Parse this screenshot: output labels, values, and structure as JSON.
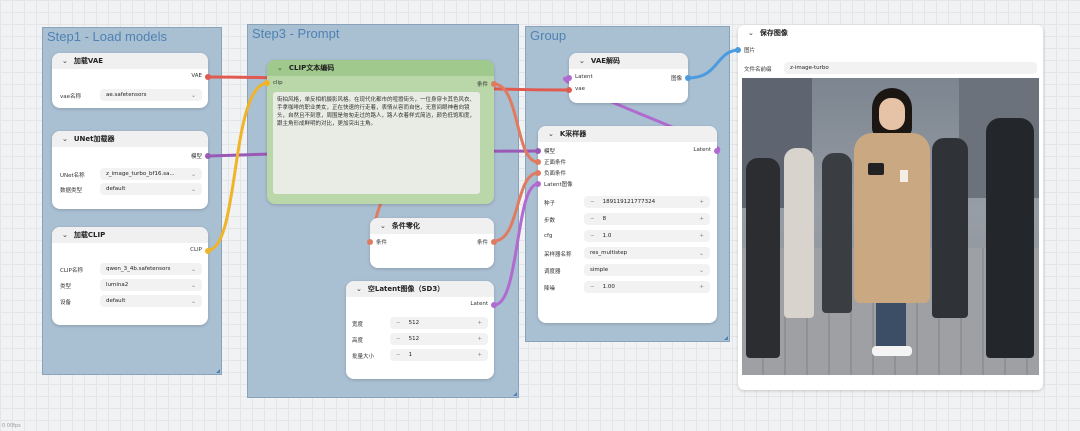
{
  "groups": {
    "step1": "Step1 - Load models",
    "step3": "Step3 - Prompt",
    "group": "Group"
  },
  "vae_loader": {
    "title": "加载VAE",
    "output": "VAE",
    "field_label": "vae名称",
    "field_value": "ae.safetensors"
  },
  "unet_loader": {
    "title": "UNet加载器",
    "output": "模型",
    "name_label": "UNet名称",
    "name_value": "z_image_turbo_bf16.sa...",
    "dtype_label": "数据类型",
    "dtype_value": "default"
  },
  "clip_loader": {
    "title": "加载CLIP",
    "output": "CLIP",
    "name_label": "CLIP名称",
    "name_value": "qwen_3_4b.safetensors",
    "type_label": "类型",
    "type_value": "lumina2",
    "device_label": "设备",
    "device_value": "default"
  },
  "clip_encode": {
    "title": "CLIP文本编码",
    "input": "clip",
    "output": "条件",
    "prompt": "街拍风格，单反相机摄影风格。在现代化都市的喧嚣街头，一位身穿卡其色风衣、手拿咖啡的职业美女，正在快速的行走着，表情从容而自信，无意间眼神看向镜头，自然且不刻意，周围是匆匆走过的路人，路人衣着样式简洁，颜色低饱和度，跟主角形成鲜明的对比，更加突出主角。"
  },
  "cond_zero": {
    "title": "条件零化",
    "input": "条件",
    "output": "条件"
  },
  "empty_latent": {
    "title": "空Latent图像（SD3）",
    "output": "Latent",
    "width_label": "宽度",
    "width_value": "512",
    "height_label": "高度",
    "height_value": "512",
    "batch_label": "批量大小",
    "batch_value": "1"
  },
  "vae_decode": {
    "title": "VAE解码",
    "input_latent": "Latent",
    "input_vae": "vae",
    "output": "图像"
  },
  "ksampler": {
    "title": "K采样器",
    "in_model": "模型",
    "in_pos": "正面条件",
    "in_neg": "负面条件",
    "in_latent": "Latent图像",
    "output": "Latent",
    "seed_label": "种子",
    "seed_value": "189119121777324",
    "steps_label": "步数",
    "steps_value": "8",
    "cfg_label": "cfg",
    "cfg_value": "1.0",
    "sampler_label": "采样器名称",
    "sampler_value": "res_multistep",
    "scheduler_label": "调度器",
    "scheduler_value": "simple",
    "denoise_label": "降噪",
    "denoise_value": "1.00"
  },
  "save_image": {
    "title": "保存图像",
    "input": "图片",
    "prefix_label": "文件名前缀",
    "prefix_value": "z-image-turbo"
  },
  "footer": {
    "zoom": "0 00fps"
  },
  "colors": {
    "vae": "#e05a4f",
    "model": "#9b59b6",
    "clip": "#f0b429",
    "cond": "#e07b5f",
    "latent": "#b06ad0",
    "image": "#4a9be0",
    "group_bg": "#a9bfd2",
    "clip_node": "#b9d7a8"
  },
  "icons": [
    "chevron-down-icon",
    "dropdown-arrow-icon",
    "minus-icon",
    "plus-icon"
  ]
}
